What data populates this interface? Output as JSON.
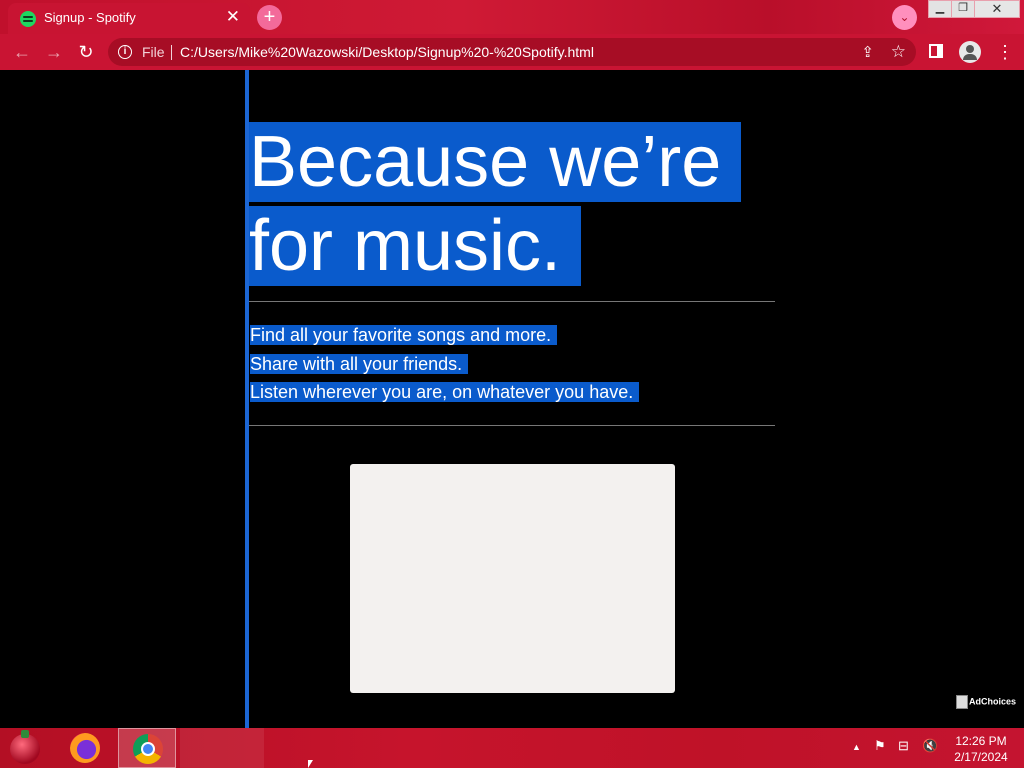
{
  "browser": {
    "tab_title": "Signup - Spotify",
    "tab_close": "✕",
    "new_tab": "+",
    "tab_search": "⌄",
    "window_controls": {
      "minimize": "▁",
      "maximize": "❐",
      "close": "✕"
    },
    "nav": {
      "back": "←",
      "forward": "→",
      "reload": "↻"
    },
    "address": {
      "scheme_label": "File",
      "url": "C:/Users/Mike%20Wazowski/Desktop/Signup%20-%20Spotify.html",
      "info_icon": "i",
      "share_icon": "⇪",
      "star_icon": "☆"
    },
    "menu_icon": "⋮"
  },
  "page": {
    "headline_line1": "Because we’re",
    "headline_line2": "for music.",
    "taglines": [
      "Find all your favorite songs and more.",
      "Share with all your friends.",
      "Listen wherever you are, on whatever you have."
    ],
    "adchoices": "AdChoices",
    "accent_color": "#0a5bcc"
  },
  "taskbar": {
    "tray_up": "▲",
    "tray_flag": "⚑",
    "tray_net": "⊟",
    "tray_vol": "🔇",
    "time": "12:26 PM",
    "date": "2/17/2024"
  }
}
